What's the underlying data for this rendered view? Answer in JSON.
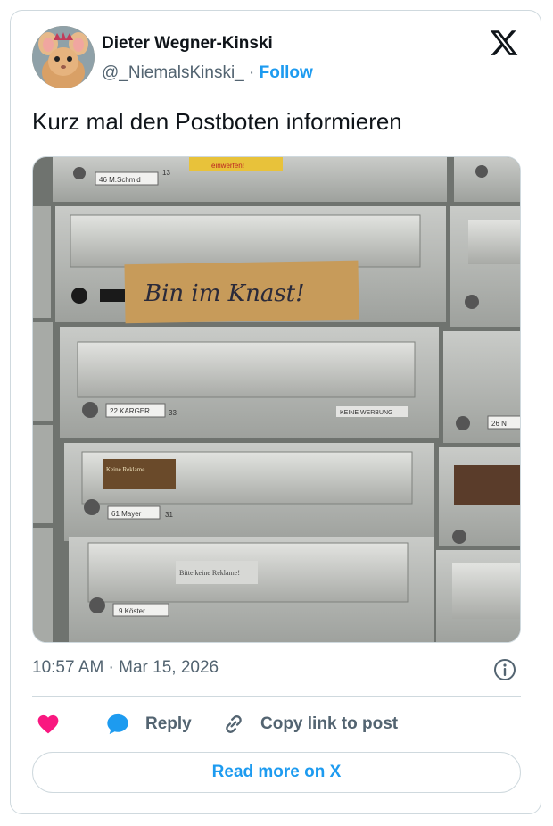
{
  "author": {
    "name": "Dieter Wegner-Kinski",
    "handle": "@_NiemalsKinski_",
    "separator": " · ",
    "follow_label": "Follow"
  },
  "tweet": {
    "text": "Kurz mal den Postboten informieren"
  },
  "photo": {
    "note_text": "Bin im Knast!",
    "label_top_left": "46 M.Schmid",
    "label_top_num": "13",
    "label_top_tag": "einwerfen!",
    "label_mid": "22 KARGER",
    "label_mid_num": "33",
    "label_mid_right": "KEINE WERBUNG",
    "label_low": "61 Mayer",
    "label_low_num": "31",
    "label_sticker": "Keine Reklame",
    "label_bottom_note": "Bitte keine Reklame!",
    "label_bottom": "9 Köster",
    "label_right": "26 N"
  },
  "meta": {
    "timestamp": "10:57 AM · Mar 15, 2026"
  },
  "actions": {
    "reply_label": "Reply",
    "copy_label": "Copy link to post",
    "read_more_label": "Read more on X"
  },
  "icons": {
    "heart": "heart-icon",
    "reply": "speech-bubble-icon",
    "copy": "link-icon",
    "info": "info-icon",
    "logo": "x-logo-icon"
  },
  "colors": {
    "heart": "#f91880",
    "link": "#1d9bf0",
    "text": "#0f1419",
    "muted": "#536471",
    "border": "#cfd9de"
  }
}
